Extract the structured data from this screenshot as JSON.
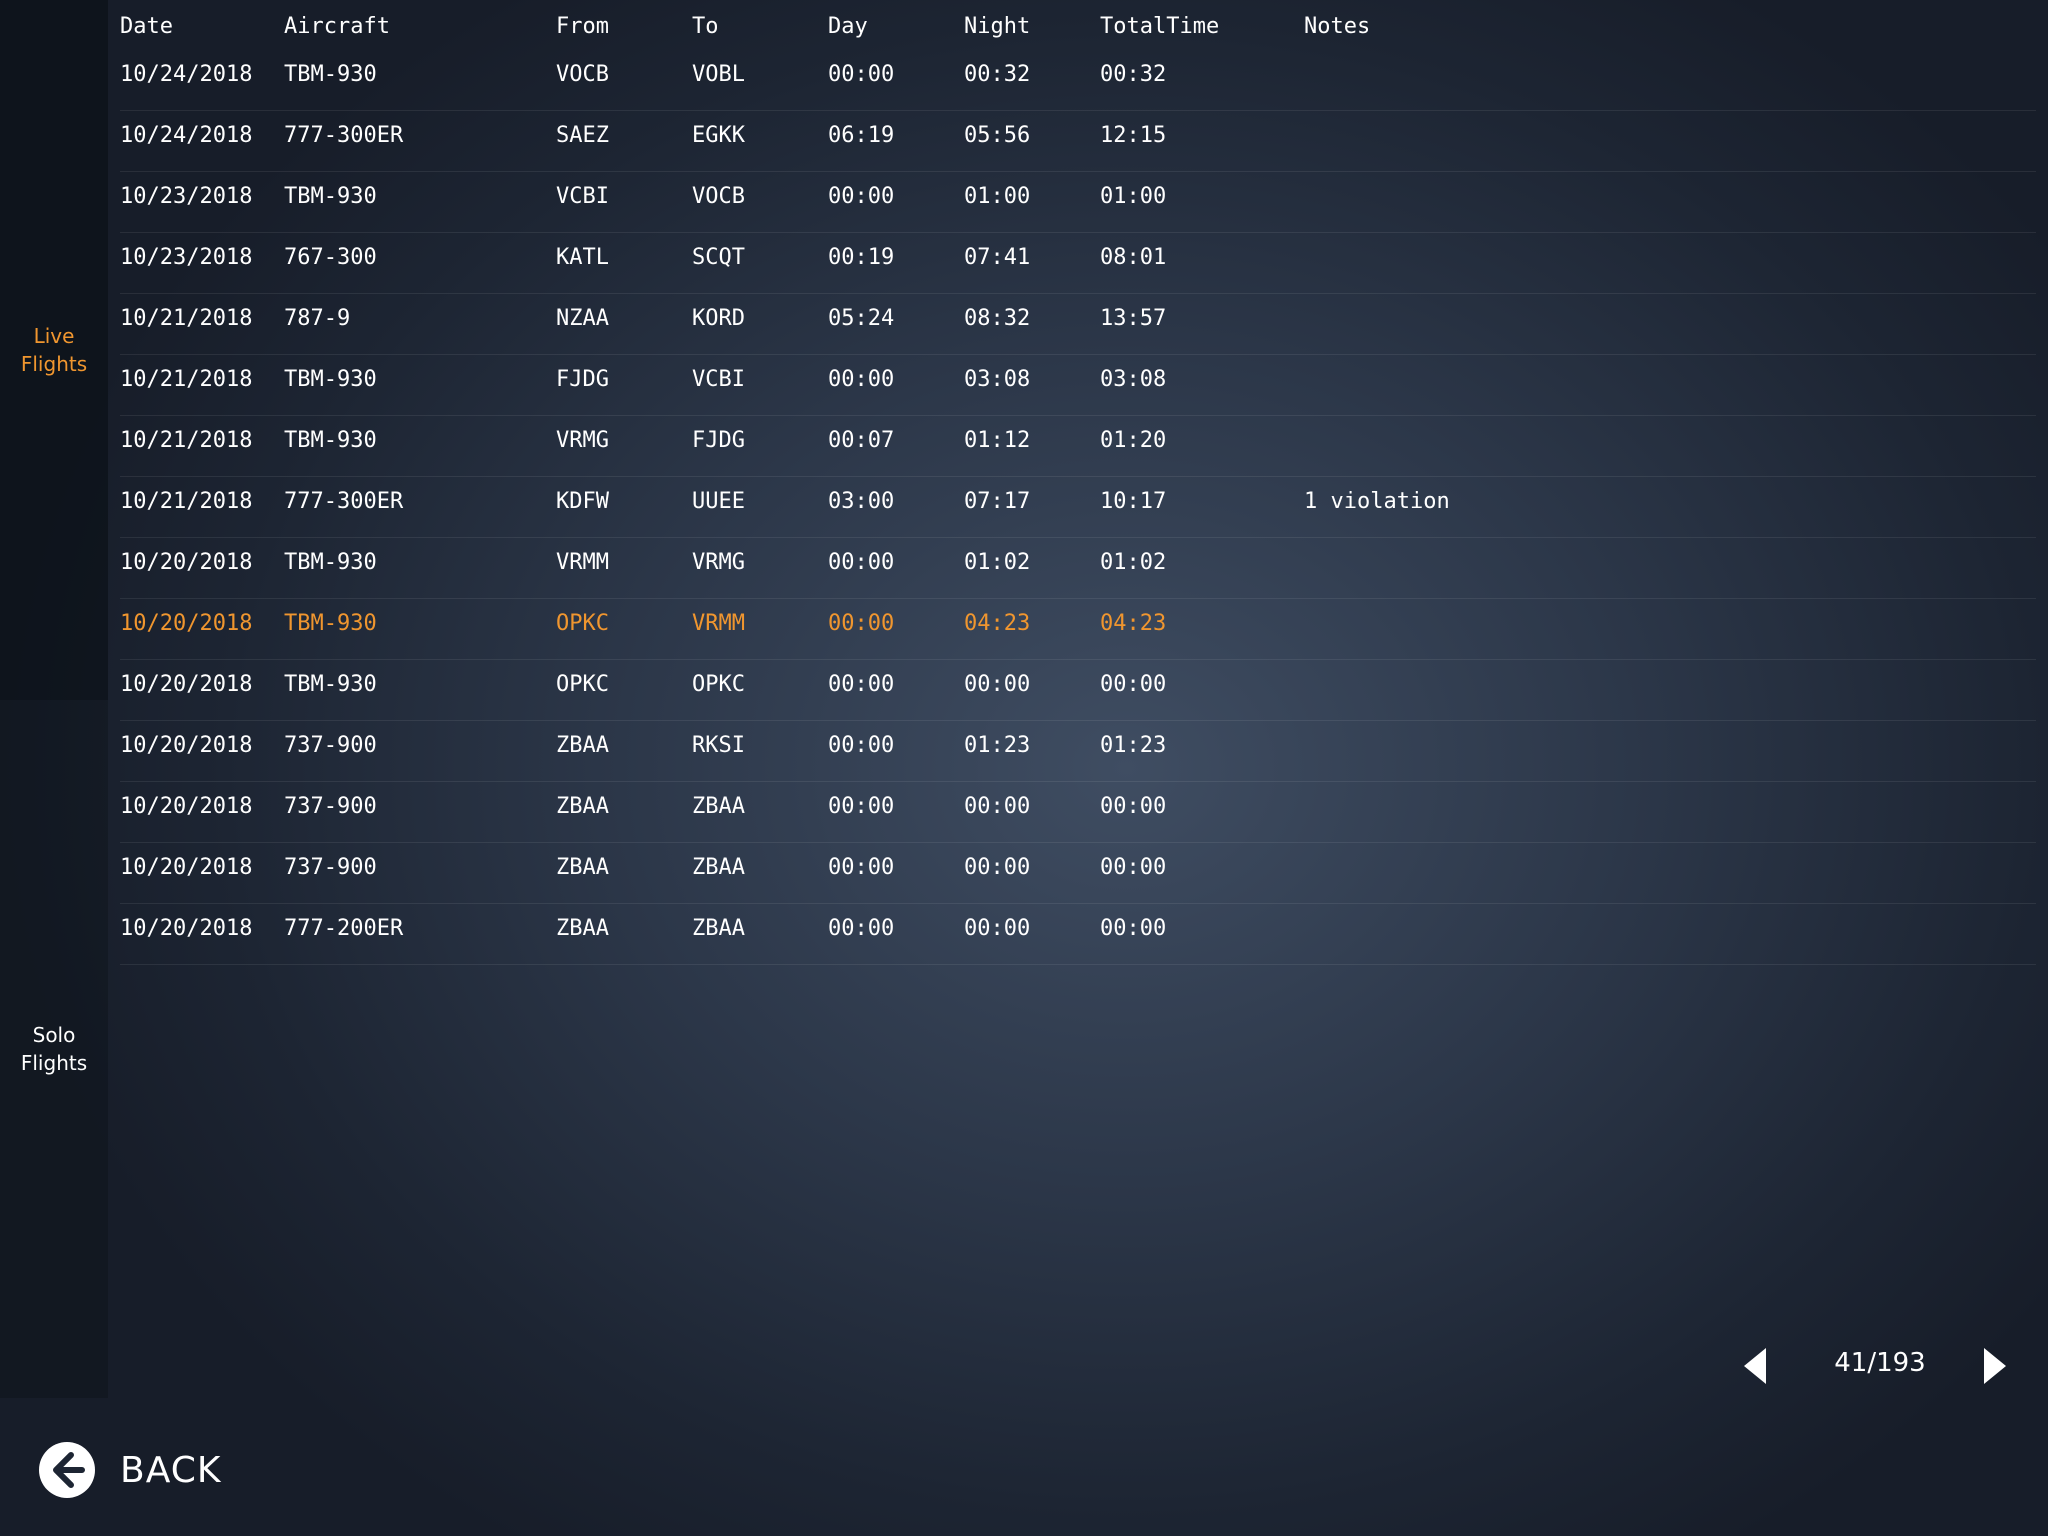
{
  "sidebar": {
    "tabs": [
      {
        "label": "Live Flights",
        "active": true
      },
      {
        "label_line1": "Solo",
        "label_line2": "Flights",
        "active": false
      }
    ]
  },
  "table": {
    "headers": {
      "date": "Date",
      "aircraft": "Aircraft",
      "from": "From",
      "to": "To",
      "day": "Day",
      "night": "Night",
      "total": "TotalTime",
      "notes": "Notes"
    },
    "rows": [
      {
        "date": "10/24/2018",
        "aircraft": "TBM-930",
        "from": "VOCB",
        "to": "VOBL",
        "day": "00:00",
        "night": "00:32",
        "total": "00:32",
        "notes": ""
      },
      {
        "date": "10/24/2018",
        "aircraft": "777-300ER",
        "from": "SAEZ",
        "to": "EGKK",
        "day": "06:19",
        "night": "05:56",
        "total": "12:15",
        "notes": ""
      },
      {
        "date": "10/23/2018",
        "aircraft": "TBM-930",
        "from": "VCBI",
        "to": "VOCB",
        "day": "00:00",
        "night": "01:00",
        "total": "01:00",
        "notes": ""
      },
      {
        "date": "10/23/2018",
        "aircraft": "767-300",
        "from": "KATL",
        "to": "SCQT",
        "day": "00:19",
        "night": "07:41",
        "total": "08:01",
        "notes": ""
      },
      {
        "date": "10/21/2018",
        "aircraft": "787-9",
        "from": "NZAA",
        "to": "KORD",
        "day": "05:24",
        "night": "08:32",
        "total": "13:57",
        "notes": ""
      },
      {
        "date": "10/21/2018",
        "aircraft": "TBM-930",
        "from": "FJDG",
        "to": "VCBI",
        "day": "00:00",
        "night": "03:08",
        "total": "03:08",
        "notes": ""
      },
      {
        "date": "10/21/2018",
        "aircraft": "TBM-930",
        "from": "VRMG",
        "to": "FJDG",
        "day": "00:07",
        "night": "01:12",
        "total": "01:20",
        "notes": ""
      },
      {
        "date": "10/21/2018",
        "aircraft": "777-300ER",
        "from": "KDFW",
        "to": "UUEE",
        "day": "03:00",
        "night": "07:17",
        "total": "10:17",
        "notes": "1 violation"
      },
      {
        "date": "10/20/2018",
        "aircraft": "TBM-930",
        "from": "VRMM",
        "to": "VRMG",
        "day": "00:00",
        "night": "01:02",
        "total": "01:02",
        "notes": ""
      },
      {
        "date": "10/20/2018",
        "aircraft": "TBM-930",
        "from": "OPKC",
        "to": "VRMM",
        "day": "00:00",
        "night": "04:23",
        "total": "04:23",
        "notes": "",
        "selected": true
      },
      {
        "date": "10/20/2018",
        "aircraft": "TBM-930",
        "from": "OPKC",
        "to": "OPKC",
        "day": "00:00",
        "night": "00:00",
        "total": "00:00",
        "notes": ""
      },
      {
        "date": "10/20/2018",
        "aircraft": "737-900",
        "from": "ZBAA",
        "to": "RKSI",
        "day": "00:00",
        "night": "01:23",
        "total": "01:23",
        "notes": ""
      },
      {
        "date": "10/20/2018",
        "aircraft": "737-900",
        "from": "ZBAA",
        "to": "ZBAA",
        "day": "00:00",
        "night": "00:00",
        "total": "00:00",
        "notes": ""
      },
      {
        "date": "10/20/2018",
        "aircraft": "737-900",
        "from": "ZBAA",
        "to": "ZBAA",
        "day": "00:00",
        "night": "00:00",
        "total": "00:00",
        "notes": ""
      },
      {
        "date": "10/20/2018",
        "aircraft": "777-200ER",
        "from": "ZBAA",
        "to": "ZBAA",
        "day": "00:00",
        "night": "00:00",
        "total": "00:00",
        "notes": ""
      }
    ]
  },
  "pager": {
    "label": "41/193",
    "prev_icon": "triangle-left-icon",
    "next_icon": "triangle-right-icon"
  },
  "back": {
    "label": "BACK",
    "icon": "arrow-left-circle-icon"
  },
  "colors": {
    "accent": "#f0962f",
    "text": "#ffffff"
  }
}
